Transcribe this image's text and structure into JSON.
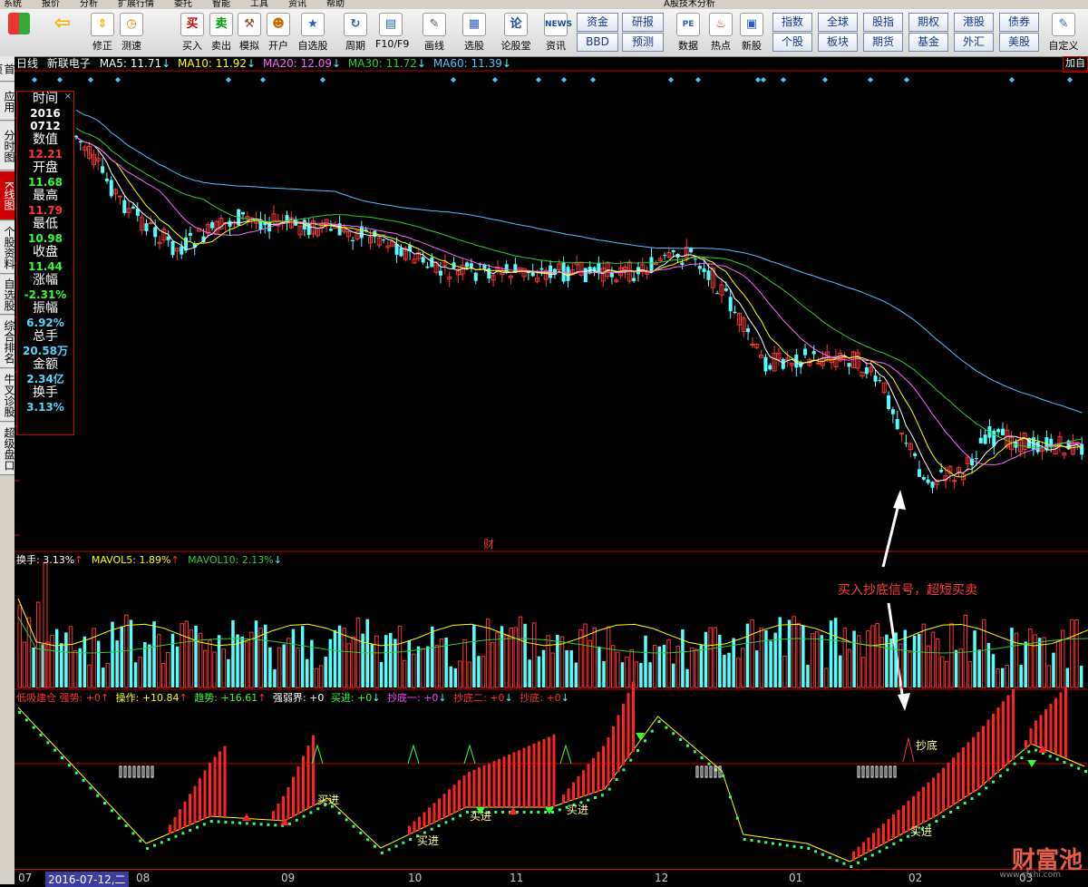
{
  "menu": [
    "系统",
    "报价",
    "分析",
    "扩展行情",
    "委托",
    "智能",
    "工具",
    "资讯",
    "帮助"
  ],
  "window_title": "A股技术分析",
  "toolbar": {
    "left_buttons": [
      {
        "label": "修正",
        "icon": "up-down-arrows-icon"
      },
      {
        "label": "测速",
        "icon": "clock-icon"
      },
      {
        "label": "买入",
        "icon": "buy-icon",
        "glyph": "买"
      },
      {
        "label": "卖出",
        "icon": "sell-icon",
        "glyph": "卖"
      },
      {
        "label": "模拟",
        "icon": "hammer-icon"
      },
      {
        "label": "开户",
        "icon": "person-icon"
      },
      {
        "label": "自选股",
        "icon": "star-folder-icon"
      },
      {
        "label": "周期",
        "icon": "cycle-icon"
      },
      {
        "label": "F10/F9",
        "icon": "f10-icon"
      },
      {
        "label": "画线",
        "icon": "pen-icon"
      },
      {
        "label": "选股",
        "icon": "chart-select-icon"
      },
      {
        "label": "论股堂",
        "icon": "lun-icon",
        "glyph": "论"
      },
      {
        "label": "资讯",
        "icon": "news-icon",
        "glyph": "NEWS"
      },
      {
        "label": "数据",
        "icon": "pe-icon",
        "glyph": "PE"
      },
      {
        "label": "热点",
        "icon": "hot-icon"
      },
      {
        "label": "新股",
        "icon": "ipo-icon"
      }
    ],
    "grid_a": [
      "资金",
      "研报",
      "BBD",
      "预测"
    ],
    "grid_b": [
      "指数",
      "全球",
      "股指",
      "期权",
      "港股",
      "债券",
      "个股",
      "板块",
      "期货",
      "基金",
      "外汇",
      "美股"
    ],
    "custom_label": "自定义"
  },
  "sidebar_tabs": [
    "首页",
    "应用",
    "分时图",
    "K线图",
    "个股资料",
    "自选股",
    "综合排名",
    "牛叉诊股",
    "超级盘口"
  ],
  "chart_header": {
    "period": "日线",
    "stock": "新联电子",
    "ma5": "MA5: 11.71",
    "ma10": "MA10: 11.92",
    "ma20": "MA20: 12.09",
    "ma30": "MA30: 11.72",
    "ma60": "MA60: 11.39",
    "add_right": "加自"
  },
  "info_box": [
    {
      "label": "时间",
      "value": "2016\n0712",
      "color": "#ffffff"
    },
    {
      "label": "数值",
      "value": "12.21",
      "color": "#ff3333"
    },
    {
      "label": "开盘",
      "value": "11.68",
      "color": "#33ff33"
    },
    {
      "label": "最高",
      "value": "11.79",
      "color": "#ff3333"
    },
    {
      "label": "最低",
      "value": "10.98",
      "color": "#33ff33"
    },
    {
      "label": "收盘",
      "value": "11.44",
      "color": "#33ff33"
    },
    {
      "label": "涨幅",
      "value": "-2.31%",
      "color": "#33ff33"
    },
    {
      "label": "振幅",
      "value": "6.92%",
      "color": "#54d8ff"
    },
    {
      "label": "总手",
      "value": "20.58万",
      "color": "#54d8ff"
    },
    {
      "label": "金额",
      "value": "2.34亿",
      "color": "#54d8ff"
    },
    {
      "label": "换手",
      "value": "3.13%",
      "color": "#54d8ff"
    }
  ],
  "volume_header": {
    "turnover": "换手: 3.13%",
    "mavol5": "MAVOL5: 1.89%",
    "mavol10": "MAVOL10: 2.13%"
  },
  "indicator_header": {
    "name": "低吸建仓",
    "strength": "强势: +0",
    "operation": "操作: +10.84",
    "trend": "趋势: +16.61",
    "boundary": "强弱界: +0",
    "buy_in": "买进: +0",
    "bottom1": "抄底一: +0",
    "bottom2": "抄底二: +0",
    "bottom": "抄底: +0"
  },
  "signal_labels": {
    "buy": "买进",
    "bottom": "抄底",
    "finance": "财"
  },
  "annotation": "买入抄底信号，超短买卖",
  "x_axis": {
    "labels": [
      "07",
      "08",
      "09",
      "10",
      "11",
      "12",
      "01",
      "02",
      "03"
    ],
    "cursor": "2016-07-12,二"
  },
  "watermark": {
    "brand": "财富池",
    "url": "www.cfchi.com"
  },
  "colors": {
    "up": "#ff3333",
    "down": "#54ffff",
    "ma5": "#ffffff",
    "ma10": "#ffff00",
    "ma20": "#ff66ff",
    "ma30": "#33cc33",
    "ma60": "#4fc6ff",
    "border": "#c00000"
  }
}
